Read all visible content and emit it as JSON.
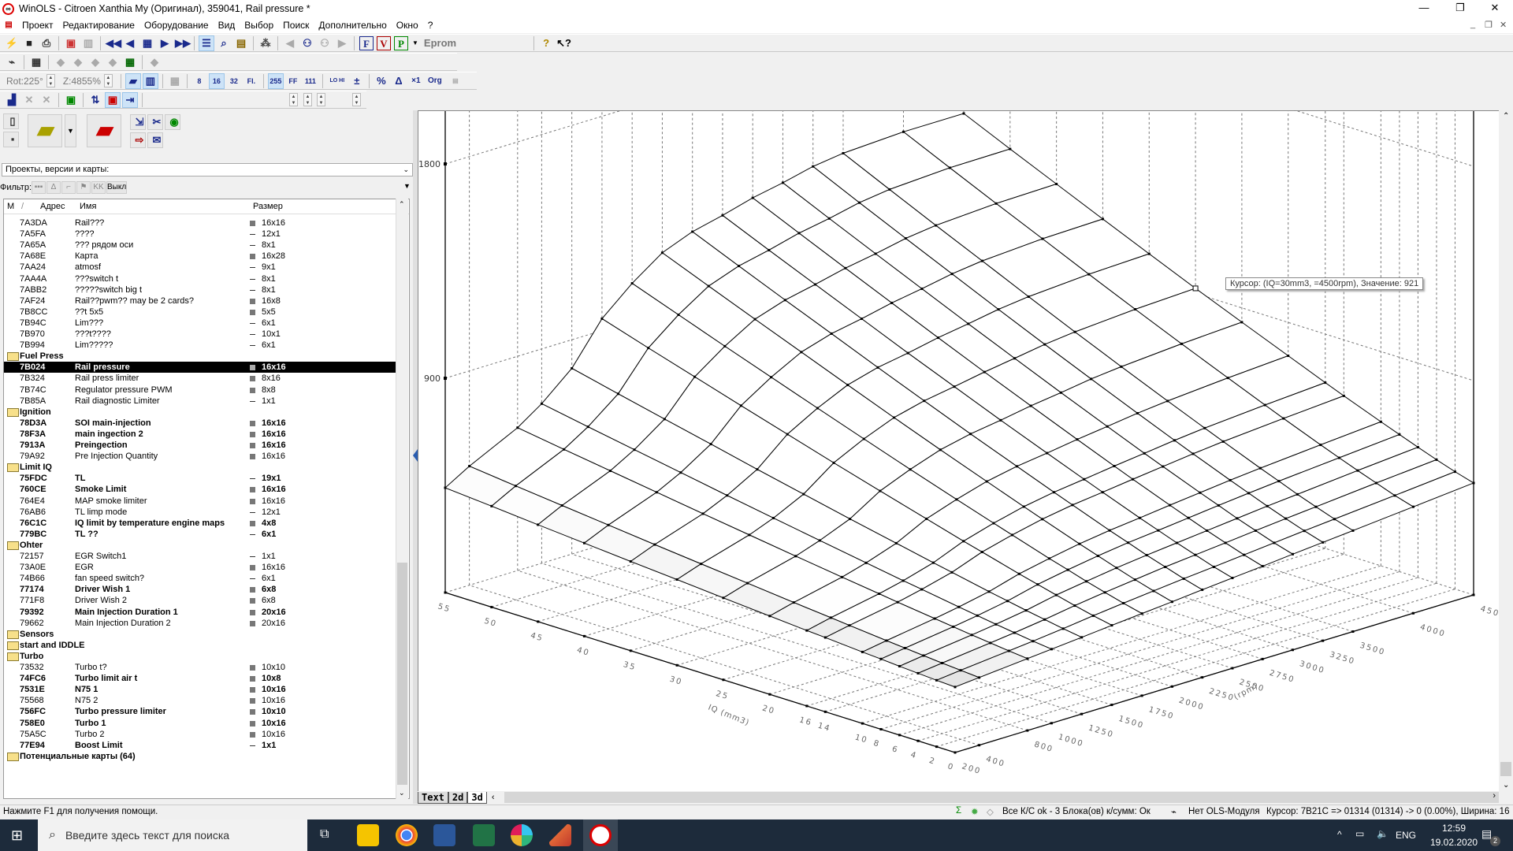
{
  "window": {
    "title": "WinOLS - Citroen Xanthia My (Оригинал), 359041, Rail pressure *",
    "minimize": "—",
    "restore": "❐",
    "close": "✕"
  },
  "menu": [
    "Проект",
    "Редактирование",
    "Оборудование",
    "Вид",
    "Выбор",
    "Поиск",
    "Дополнительно",
    "Окно",
    "?"
  ],
  "toolbar": {
    "eprom_label": "Eprom",
    "rotation": "Rot:225°",
    "zoom": "Z:4855%",
    "width_8": "8",
    "width_16": "16",
    "width_32": "32",
    "width_float": "Fl.",
    "fmt_dec": "255",
    "fmt_hex": "FF",
    "fmt_bin": "111",
    "lohi": "LO HI",
    "pct": "%",
    "delta": "Δ",
    "x1": "×1",
    "org": "Org"
  },
  "left": {
    "dropdown": "Проекты, версии и карты:",
    "filter_label": "Фильтр:",
    "filter_off": "Выкл",
    "columns": {
      "m": "M",
      "sort": "/",
      "addr": "Адрес",
      "name": "Имя",
      "size": "Размер"
    }
  },
  "tree": {
    "rows": [
      {
        "addr": "7A3DA",
        "name": "Rail???",
        "size": "16x16"
      },
      {
        "addr": "7A5FA",
        "name": "????",
        "size": "12x1"
      },
      {
        "addr": "7A65A",
        "name": "??? рядом оси",
        "size": "8x1"
      },
      {
        "addr": "7A68E",
        "name": "Карта",
        "size": "16x28"
      },
      {
        "addr": "7AA24",
        "name": "atmosf",
        "size": "9x1"
      },
      {
        "addr": "7AA4A",
        "name": "???switch t",
        "size": "8x1"
      },
      {
        "addr": "7ABB2",
        "name": "?????switch big t",
        "size": "8x1"
      },
      {
        "addr": "7AF24",
        "name": "Rail??pwm?? may be 2 cards?",
        "size": "16x8"
      },
      {
        "addr": "7B8CC",
        "name": "??t 5x5",
        "size": "5x5"
      },
      {
        "addr": "7B94C",
        "name": "Lim???",
        "size": "6x1"
      },
      {
        "addr": "7B970",
        "name": "???t????",
        "size": "10x1"
      },
      {
        "addr": "7B994",
        "name": "Lim?????",
        "size": "6x1"
      },
      {
        "folder": "Fuel Press",
        "open": true
      },
      {
        "addr": "7B024",
        "name": "Rail pressure",
        "size": "16x16",
        "bold": true,
        "selected": true
      },
      {
        "addr": "7B324",
        "name": "Rail press limiter",
        "size": "8x16"
      },
      {
        "addr": "7B74C",
        "name": "Regulator pressure PWM",
        "size": "8x8"
      },
      {
        "addr": "7B85A",
        "name": "Rail diagnostic Limiter",
        "size": "1x1"
      },
      {
        "folder": "Ignition",
        "open": true
      },
      {
        "addr": "78D3A",
        "name": "SOI main-injection",
        "size": "16x16",
        "bold": true
      },
      {
        "addr": "78F3A",
        "name": "main ingection 2",
        "size": "16x16",
        "bold": true
      },
      {
        "addr": "7913A",
        "name": "Preingection",
        "size": "16x16",
        "bold": true
      },
      {
        "addr": "79A92",
        "name": "Pre Injection Quantity",
        "size": "16x16"
      },
      {
        "folder": "Limit IQ",
        "open": true
      },
      {
        "addr": "75FDC",
        "name": "TL",
        "size": "19x1",
        "bold": true
      },
      {
        "addr": "760CE",
        "name": "Smoke Limit",
        "size": "16x16",
        "bold": true
      },
      {
        "addr": "764E4",
        "name": "MAP smoke limiter",
        "size": "16x16"
      },
      {
        "addr": "76AB6",
        "name": "TL limp mode",
        "size": "12x1"
      },
      {
        "addr": "76C1C",
        "name": "IQ limit by temperature engine maps",
        "size": "4x8",
        "bold": true
      },
      {
        "addr": "779BC",
        "name": "TL ??",
        "size": "6x1",
        "bold": true
      },
      {
        "folder": "Ohter",
        "open": true
      },
      {
        "addr": "72157",
        "name": "EGR Switch1",
        "size": "1x1"
      },
      {
        "addr": "73A0E",
        "name": "EGR",
        "size": "16x16"
      },
      {
        "addr": "74B66",
        "name": "fan speed switch?",
        "size": "6x1"
      },
      {
        "addr": "77174",
        "name": "Driver Wish 1",
        "size": "6x8",
        "bold": true
      },
      {
        "addr": "771F8",
        "name": "Driver Wish 2",
        "size": "6x8"
      },
      {
        "addr": "79392",
        "name": "Main Injection Duration 1",
        "size": "20x16",
        "bold": true
      },
      {
        "addr": "79662",
        "name": "Main Injection Duration 2",
        "size": "20x16"
      },
      {
        "folder": "Sensors",
        "open": false
      },
      {
        "folder": "start and IDDLE",
        "open": false
      },
      {
        "folder": "Turbo",
        "open": true
      },
      {
        "addr": "73532",
        "name": "Turbo t?",
        "size": "10x10"
      },
      {
        "addr": "74FC6",
        "name": "Turbo limit air t",
        "size": "10x8",
        "bold": true
      },
      {
        "addr": "7531E",
        "name": "N75 1",
        "size": "10x16",
        "bold": true
      },
      {
        "addr": "75568",
        "name": "N75 2",
        "size": "10x16"
      },
      {
        "addr": "756FC",
        "name": "Turbo pressure limiter",
        "size": "10x10",
        "bold": true
      },
      {
        "addr": "758E0",
        "name": "Turbo  1",
        "size": "10x16",
        "bold": true
      },
      {
        "addr": "75A5C",
        "name": "Turbo 2",
        "size": "10x16"
      },
      {
        "addr": "77E94",
        "name": "Boost Limit",
        "size": "1x1",
        "bold": true
      },
      {
        "folder": "Потенциальные карты (64)",
        "open": false
      }
    ]
  },
  "tabs": [
    "Text",
    "2d",
    "3d"
  ],
  "active_tab": "3d",
  "tooltip": "Курсор: (IQ=30mm3, =4500rpm), Значение: 921",
  "status": {
    "help": "Нажмите F1 для получения помощи.",
    "checksum": "Все К/С ok - 3 Блока(ов) к/сумм: Ок",
    "module": "Нет OLS-Модуля",
    "cursor": "Курсор: 7B21C => 01314 (01314) -> 0 (0.00%), Ширина: 16"
  },
  "taskbar": {
    "search_placeholder": "Введите здесь текст для поиска",
    "lang": "ENG",
    "time": "12:59",
    "date": "19.02.2020",
    "notifications": "2"
  },
  "chart_data": {
    "type": "surface3d",
    "x_label": "IQ (mm3)",
    "y_label": "(rpm)",
    "x_ticks": [
      0,
      2,
      4,
      6,
      8,
      10,
      14,
      16,
      20,
      25,
      30,
      35,
      40,
      45,
      50,
      55
    ],
    "y_ticks": [
      200,
      400,
      800,
      1000,
      1250,
      1500,
      1750,
      2000,
      2250,
      2500,
      2750,
      3000,
      3250,
      3500,
      4000,
      4500
    ],
    "z_ticks": [
      900,
      1800
    ],
    "z_range": [
      0,
      1800
    ],
    "grid": true,
    "values_rows_by_iq": [
      [
        275,
        284,
        302,
        311,
        322,
        334,
        345,
        356,
        368,
        379,
        390,
        402,
        413,
        424,
        447,
        470
      ],
      [
        279,
        290,
        310,
        320,
        334,
        350,
        364,
        377,
        390,
        401,
        413,
        425,
        437,
        448,
        470,
        493
      ],
      [
        284,
        296,
        319,
        331,
        348,
        368,
        385,
        400,
        415,
        427,
        439,
        452,
        464,
        475,
        498,
        519
      ],
      [
        289,
        303,
        328,
        342,
        362,
        388,
        407,
        425,
        440,
        453,
        466,
        479,
        492,
        503,
        526,
        547
      ],
      [
        295,
        310,
        338,
        354,
        377,
        408,
        431,
        451,
        468,
        481,
        495,
        509,
        522,
        534,
        555,
        576
      ],
      [
        300,
        317,
        348,
        366,
        392,
        428,
        454,
        477,
        495,
        509,
        524,
        538,
        552,
        564,
        585,
        605
      ],
      [
        312,
        332,
        368,
        391,
        424,
        471,
        504,
        532,
        553,
        568,
        584,
        599,
        614,
        627,
        647,
        665
      ],
      [
        317,
        340,
        379,
        403,
        440,
        492,
        529,
        560,
        582,
        598,
        615,
        630,
        646,
        659,
        679,
        696
      ],
      [
        329,
        355,
        400,
        429,
        473,
        537,
        580,
        617,
        642,
        659,
        678,
        694,
        711,
        724,
        744,
        760
      ],
      [
        344,
        375,
        427,
        462,
        514,
        593,
        645,
        689,
        717,
        736,
        758,
        775,
        794,
        807,
        826,
        840
      ],
      [
        360,
        395,
        455,
        495,
        557,
        650,
        712,
        763,
        795,
        816,
        839,
        858,
        878,
        892,
        910,
        921
      ],
      [
        375,
        415,
        483,
        529,
        600,
        709,
        780,
        839,
        874,
        896,
        922,
        942,
        964,
        979,
        996,
        1005
      ],
      [
        391,
        436,
        512,
        564,
        645,
        768,
        849,
        916,
        955,
        979,
        1007,
        1028,
        1052,
        1068,
        1084,
        1090
      ],
      [
        407,
        457,
        541,
        599,
        689,
        828,
        918,
        993,
        1035,
        1062,
        1092,
        1114,
        1140,
        1156,
        1171,
        1176
      ],
      [
        424,
        478,
        570,
        634,
        734,
        888,
        989,
        1071,
        1117,
        1145,
        1178,
        1201,
        1229,
        1246,
        1260,
        1262
      ],
      [
        440,
        500,
        600,
        670,
        780,
        950,
        1060,
        1150,
        1200,
        1230,
        1265,
        1290,
        1320,
        1337,
        1350,
        1350
      ]
    ],
    "cursor": {
      "iq": 30,
      "rpm": 4500,
      "value": 921
    }
  }
}
